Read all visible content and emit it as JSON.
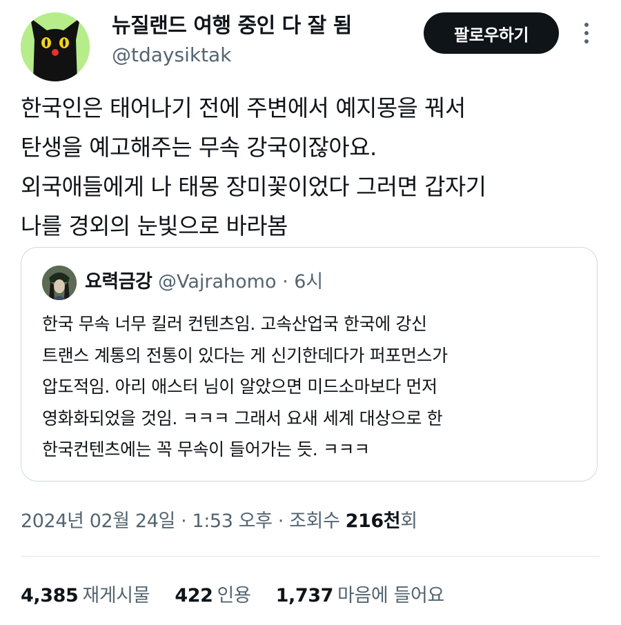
{
  "author": {
    "display_name": "뉴질랜드 여행 중인 다 잘 됨",
    "handle": "@tdaysiktak",
    "avatar": "black-cat-avatar"
  },
  "follow_label": "팔로우하기",
  "more_icon": "more-vertical-icon",
  "tweet_text": "한국인은 태어나기 전에 주변에서 예지몽을 꿔서\n탄생을 예고해주는 무속 강국이잖아요.\n외국애들에게 나 태몽 장미꽃이었다 그러면 갑자기\n나를 경외의 눈빛으로 바라봄",
  "quote": {
    "name": "요력금강",
    "handle": "@Vajrahomo",
    "time": "· 6시",
    "text": "한국 무속 너무 킬러 컨텐츠임. 고속산업국 한국에 강신\n트랜스 계통의 전통이 있다는 게 신기한데다가 퍼포먼스가\n압도적임. 아리 애스터 님이 알았으면 미드소마보다 먼저\n영화화되었을 것임. ㅋㅋㅋ 그래서 요새 세계 대상으로 한\n한국컨텐츠에는 꼭 무속이 들어가는 듯. ㅋㅋㅋ"
  },
  "meta": {
    "datetime": "2024년 02월 24일 · 1:53 오후 · 조회수 ",
    "views": "216천",
    "views_suffix": "회"
  },
  "stats": [
    {
      "value": "4,385",
      "label": "재게시물"
    },
    {
      "value": "422",
      "label": "인용"
    },
    {
      "value": "1,737",
      "label": "마음에 들어요"
    }
  ],
  "colors": {
    "text": "#0f1419",
    "muted": "#536471",
    "border": "#cfd9de",
    "avatar_bg": "#b6ec8a"
  }
}
